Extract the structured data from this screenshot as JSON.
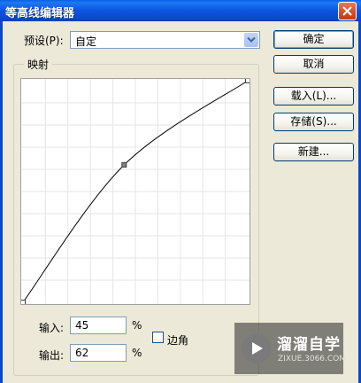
{
  "window": {
    "title": "等高线编辑器",
    "close_icon": "close-icon"
  },
  "preset": {
    "label": "预设(P):",
    "value": "自定"
  },
  "mapping": {
    "group_title": "映射"
  },
  "curve": {
    "points": [
      [
        0,
        0
      ],
      [
        45,
        62
      ],
      [
        100,
        100
      ]
    ],
    "line_color": "#000000",
    "grid_color": "#e6e6e6"
  },
  "inputs": {
    "input_label": "输入:",
    "input_value": "45",
    "output_label": "输出:",
    "output_value": "62",
    "unit": "%"
  },
  "corner": {
    "label": "边角",
    "checked": false
  },
  "buttons": {
    "ok": "确定",
    "cancel": "取消",
    "load": "载入(L)...",
    "save": "存储(S)...",
    "new": "新建..."
  },
  "watermark": {
    "name": "溜溜自学",
    "url": "ZIXUE.3066.COM"
  }
}
